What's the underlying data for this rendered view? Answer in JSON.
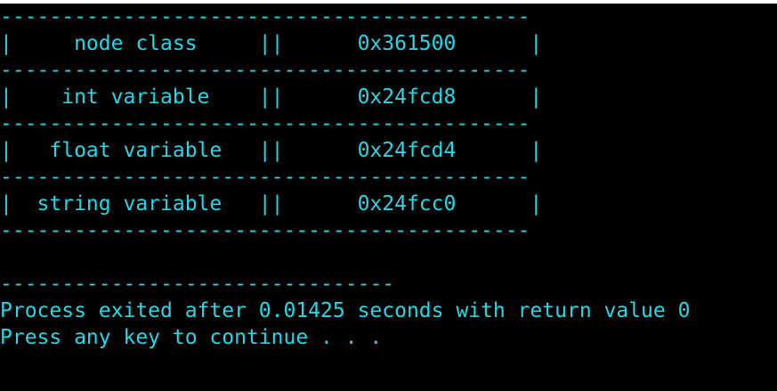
{
  "colors": {
    "background": "#000000",
    "text": "#29d6e6"
  },
  "console": {
    "lines": [
      "-------------------------------------------",
      "|     node class     ||      0x361500      |",
      "-------------------------------------------",
      "|    int variable    ||      0x24fcd8      |",
      "-------------------------------------------",
      "|   float variable   ||      0x24fcd4      |",
      "-------------------------------------------",
      "|  string variable   ||      0x24fcc0      |",
      "-------------------------------------------",
      "",
      "--------------------------------",
      "Process exited after 0.01425 seconds with return value 0",
      "Press any key to continue . . ."
    ]
  }
}
